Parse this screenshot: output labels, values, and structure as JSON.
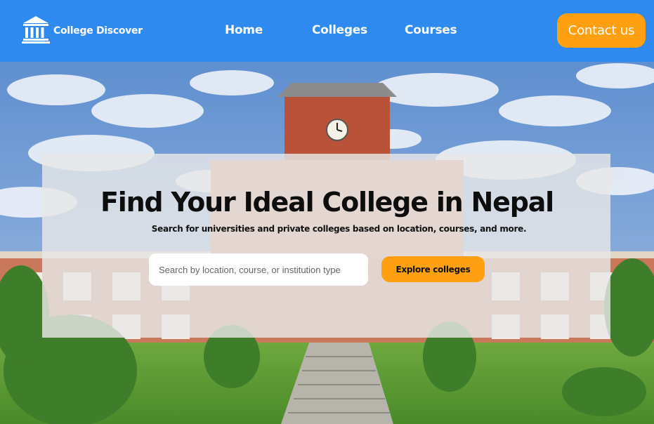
{
  "brand": {
    "name": "College Discover",
    "icon": "institution-icon"
  },
  "nav": {
    "home": "Home",
    "colleges": "Colleges",
    "courses": "Courses",
    "contact": "Contact us"
  },
  "hero": {
    "title": "Find Your Ideal College in Nepal",
    "subtitle": "Search for universities and private colleges based on location, courses, and more.",
    "search_placeholder": "Search by location, course, or institution type",
    "cta": "Explore colleges"
  },
  "colors": {
    "header_bg": "#2f8af0",
    "accent": "#ff9f12"
  }
}
